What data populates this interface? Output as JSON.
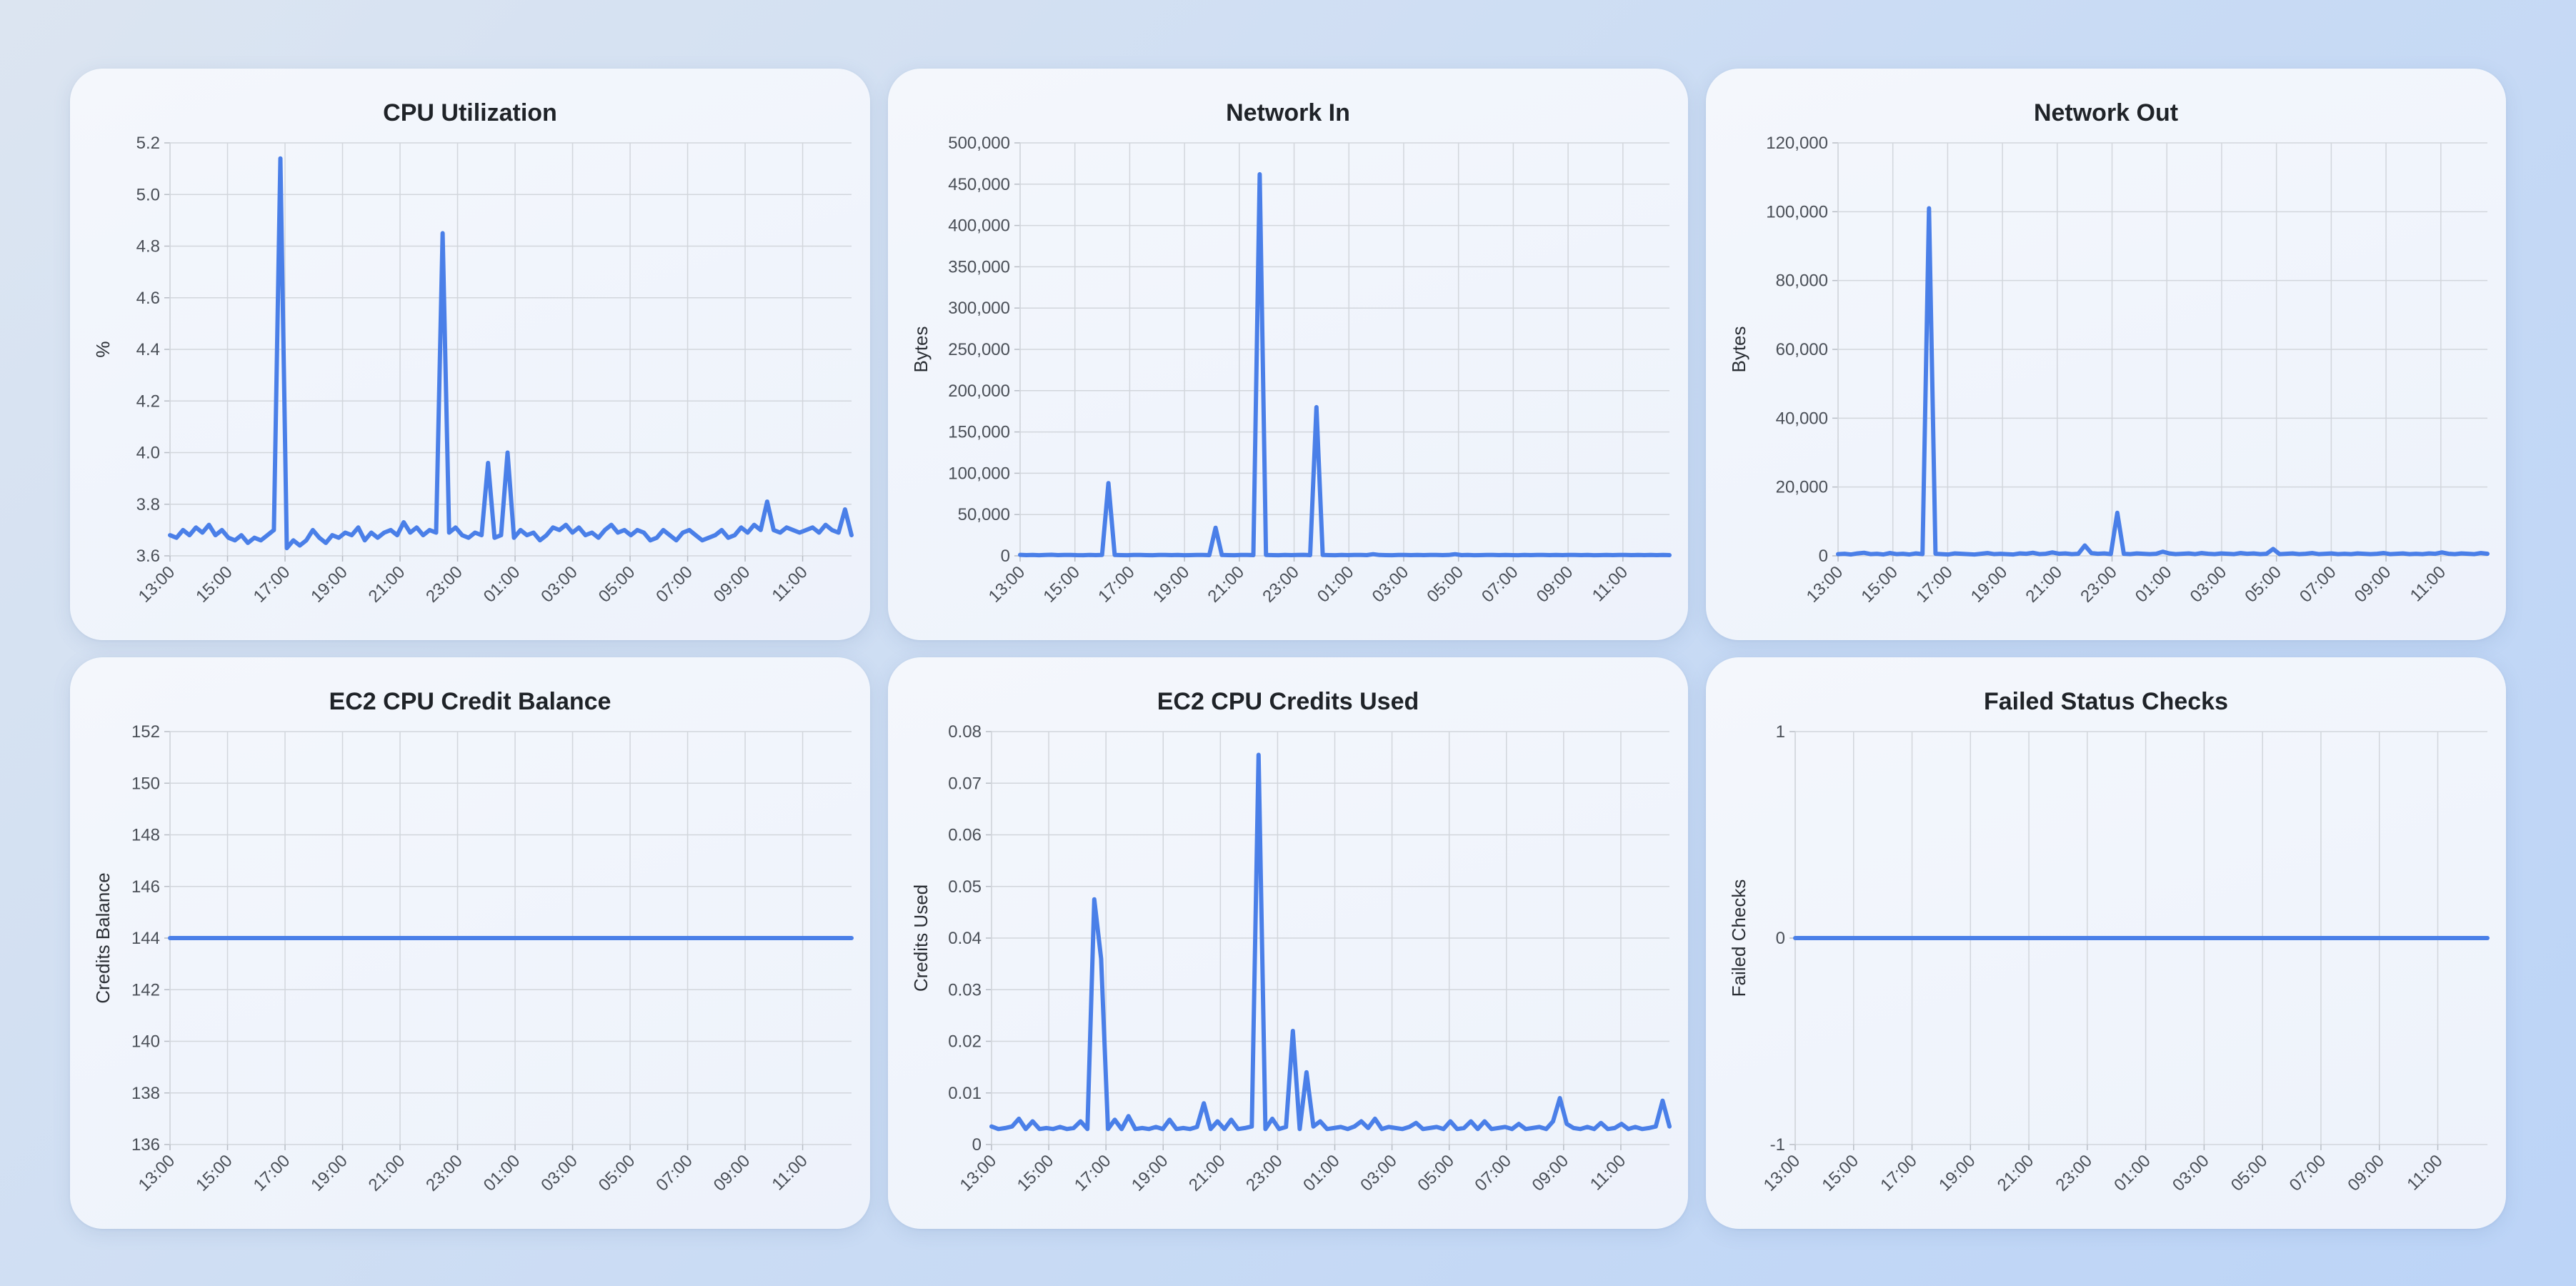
{
  "colors": {
    "line": "#4a7fe8",
    "grid": "#d2d6dc",
    "text": "#1f2328"
  },
  "chart_data": [
    {
      "type": "line",
      "title": "CPU Utilization",
      "ylabel": "%",
      "ylim": [
        3.6,
        5.2
      ],
      "yticks": [
        "3.6",
        "3.8",
        "4.0",
        "4.2",
        "4.4",
        "4.6",
        "4.8",
        "5.0",
        "5.2"
      ],
      "xticks": [
        "13:00",
        "15:00",
        "17:00",
        "19:00",
        "21:00",
        "23:00",
        "01:00",
        "03:00",
        "05:00",
        "07:00",
        "09:00",
        "11:00"
      ],
      "x_start_hour": 13,
      "x_end_hour": 36.7,
      "series": [
        {
          "values": [
            3.68,
            3.67,
            3.7,
            3.68,
            3.71,
            3.69,
            3.72,
            3.68,
            3.7,
            3.67,
            3.66,
            3.68,
            3.65,
            3.67,
            3.66,
            3.68,
            3.7,
            5.14,
            3.63,
            3.66,
            3.64,
            3.66,
            3.7,
            3.67,
            3.65,
            3.68,
            3.67,
            3.69,
            3.68,
            3.71,
            3.66,
            3.69,
            3.67,
            3.69,
            3.7,
            3.68,
            3.73,
            3.69,
            3.71,
            3.68,
            3.7,
            3.69,
            4.85,
            3.69,
            3.71,
            3.68,
            3.67,
            3.69,
            3.68,
            3.96,
            3.67,
            3.68,
            4.0,
            3.67,
            3.7,
            3.68,
            3.69,
            3.66,
            3.68,
            3.71,
            3.7,
            3.72,
            3.69,
            3.71,
            3.68,
            3.69,
            3.67,
            3.7,
            3.72,
            3.69,
            3.7,
            3.68,
            3.7,
            3.69,
            3.66,
            3.67,
            3.7,
            3.68,
            3.66,
            3.69,
            3.7,
            3.68,
            3.66,
            3.67,
            3.68,
            3.7,
            3.67,
            3.68,
            3.71,
            3.69,
            3.72,
            3.7,
            3.81,
            3.7,
            3.69,
            3.71,
            3.7,
            3.69,
            3.7,
            3.71,
            3.69,
            3.72,
            3.7,
            3.69,
            3.78,
            3.68
          ]
        }
      ]
    },
    {
      "type": "line",
      "title": "Network In",
      "ylabel": "Bytes",
      "ylim": [
        0,
        500000
      ],
      "yticks": [
        "0",
        "50,000",
        "100,000",
        "150,000",
        "200,000",
        "250,000",
        "300,000",
        "350,000",
        "400,000",
        "450,000",
        "500,000"
      ],
      "xticks": [
        "13:00",
        "15:00",
        "17:00",
        "19:00",
        "21:00",
        "23:00",
        "01:00",
        "03:00",
        "05:00",
        "07:00",
        "09:00",
        "11:00"
      ],
      "x_start_hour": 13,
      "x_end_hour": 36.7,
      "series": [
        {
          "values": [
            1200,
            900,
            1100,
            800,
            1000,
            1300,
            900,
            1000,
            1100,
            900,
            800,
            1000,
            900,
            1100,
            88000,
            1000,
            900,
            800,
            1100,
            1000,
            900,
            800,
            1000,
            1100,
            900,
            1000,
            800,
            900,
            1000,
            1100,
            900,
            34000,
            1000,
            900,
            800,
            1000,
            1100,
            900,
            462000,
            1000,
            900,
            800,
            1100,
            900,
            1000,
            1200,
            900,
            180000,
            1000,
            900,
            800,
            1000,
            900,
            1100,
            1000,
            900,
            2000,
            1000,
            900,
            800,
            1000,
            1100,
            900,
            1000,
            900,
            1000,
            1100,
            900,
            1000,
            2000,
            900,
            1000,
            800,
            900,
            1000,
            1100,
            900,
            1000,
            900,
            800,
            1000,
            900,
            1100,
            1000,
            900,
            1000,
            900,
            1000,
            1100,
            900,
            1000,
            800,
            900,
            1000,
            900,
            1100,
            1000,
            900,
            1000,
            900,
            1000,
            900,
            1100,
            900
          ]
        }
      ]
    },
    {
      "type": "line",
      "title": "Network Out",
      "ylabel": "Bytes",
      "ylim": [
        0,
        120000
      ],
      "yticks": [
        "0",
        "20,000",
        "40,000",
        "60,000",
        "80,000",
        "100,000",
        "120,000"
      ],
      "xticks": [
        "13:00",
        "15:00",
        "17:00",
        "19:00",
        "21:00",
        "23:00",
        "01:00",
        "03:00",
        "05:00",
        "07:00",
        "09:00",
        "11:00"
      ],
      "x_start_hour": 13,
      "x_end_hour": 36.7,
      "series": [
        {
          "values": [
            500,
            600,
            400,
            700,
            900,
            500,
            600,
            400,
            800,
            500,
            600,
            400,
            700,
            500,
            101000,
            600,
            500,
            400,
            700,
            600,
            500,
            400,
            600,
            800,
            500,
            600,
            500,
            400,
            700,
            600,
            900,
            500,
            600,
            1000,
            600,
            700,
            500,
            600,
            3000,
            800,
            600,
            700,
            500,
            12500,
            600,
            500,
            700,
            600,
            500,
            600,
            1200,
            700,
            500,
            600,
            700,
            500,
            800,
            600,
            500,
            700,
            600,
            500,
            800,
            600,
            700,
            500,
            600,
            2000,
            500,
            600,
            700,
            500,
            600,
            800,
            500,
            600,
            700,
            500,
            600,
            500,
            700,
            600,
            500,
            600,
            800,
            500,
            600,
            700,
            500,
            600,
            500,
            700,
            600,
            1000,
            600,
            500,
            700,
            600,
            500,
            800,
            600
          ]
        }
      ]
    },
    {
      "type": "line",
      "title": "EC2 CPU Credit Balance",
      "ylabel": "Credits Balance",
      "ylim": [
        136,
        152
      ],
      "yticks": [
        "136",
        "138",
        "140",
        "142",
        "144",
        "146",
        "148",
        "150",
        "152"
      ],
      "xticks": [
        "13:00",
        "15:00",
        "17:00",
        "19:00",
        "21:00",
        "23:00",
        "01:00",
        "03:00",
        "05:00",
        "07:00",
        "09:00",
        "11:00"
      ],
      "x_start_hour": 13,
      "x_end_hour": 36.7,
      "series": [
        {
          "values": [
            144,
            144
          ]
        }
      ]
    },
    {
      "type": "line",
      "title": "EC2 CPU Credits Used",
      "ylabel": "Credits Used",
      "ylim": [
        0,
        0.08
      ],
      "yticks": [
        "0",
        "0.01",
        "0.02",
        "0.03",
        "0.04",
        "0.05",
        "0.06",
        "0.07",
        "0.08"
      ],
      "xticks": [
        "13:00",
        "15:00",
        "17:00",
        "19:00",
        "21:00",
        "23:00",
        "01:00",
        "03:00",
        "05:00",
        "07:00",
        "09:00",
        "11:00"
      ],
      "x_start_hour": 13,
      "x_end_hour": 36.7,
      "series": [
        {
          "values": [
            0.0035,
            0.003,
            0.0032,
            0.0035,
            0.005,
            0.003,
            0.0045,
            0.003,
            0.0032,
            0.003,
            0.0034,
            0.003,
            0.0032,
            0.0045,
            0.003,
            0.0475,
            0.036,
            0.003,
            0.0048,
            0.003,
            0.0055,
            0.003,
            0.0032,
            0.003,
            0.0034,
            0.003,
            0.0048,
            0.003,
            0.0032,
            0.003,
            0.0034,
            0.008,
            0.003,
            0.0045,
            0.003,
            0.0048,
            0.003,
            0.0032,
            0.0035,
            0.0755,
            0.003,
            0.005,
            0.003,
            0.0034,
            0.022,
            0.003,
            0.014,
            0.0035,
            0.0045,
            0.003,
            0.0032,
            0.0034,
            0.003,
            0.0035,
            0.0045,
            0.0032,
            0.005,
            0.003,
            0.0034,
            0.0032,
            0.003,
            0.0034,
            0.0042,
            0.003,
            0.0032,
            0.0034,
            0.003,
            0.0045,
            0.003,
            0.0032,
            0.0045,
            0.003,
            0.0045,
            0.003,
            0.0032,
            0.0034,
            0.003,
            0.004,
            0.003,
            0.0032,
            0.0034,
            0.003,
            0.0045,
            0.009,
            0.004,
            0.0032,
            0.003,
            0.0034,
            0.003,
            0.0042,
            0.003,
            0.0032,
            0.004,
            0.003,
            0.0034,
            0.003,
            0.0032,
            0.0035,
            0.0085,
            0.0035
          ]
        }
      ]
    },
    {
      "type": "line",
      "title": "Failed Status Checks",
      "ylabel": "Failed Checks",
      "ylim": [
        -1,
        1
      ],
      "yticks": [
        "-1",
        "0",
        "1"
      ],
      "xticks": [
        "13:00",
        "15:00",
        "17:00",
        "19:00",
        "21:00",
        "23:00",
        "01:00",
        "03:00",
        "05:00",
        "07:00",
        "09:00",
        "11:00"
      ],
      "x_start_hour": 13,
      "x_end_hour": 36.7,
      "series": [
        {
          "values": [
            0,
            0
          ]
        }
      ]
    }
  ]
}
